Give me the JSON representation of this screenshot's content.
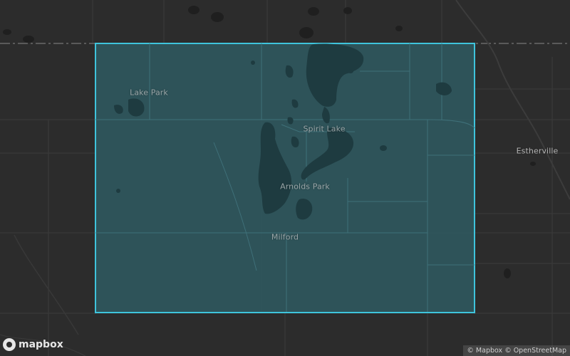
{
  "map": {
    "places": {
      "lake_park": "Lake Park",
      "spirit_lake": "Spirit Lake",
      "arnolds_park": "Arnolds Park",
      "milford": "Milford",
      "estherville": "Estherville"
    },
    "logo_text": "mapbox",
    "attribution": {
      "mapbox": "© Mapbox",
      "osm": "© OpenStreetMap"
    },
    "colors": {
      "background": "#2c2c2c",
      "selection_fill": "#2f5a62",
      "selection_stroke": "#3fc4dc",
      "water": "#1e3b40",
      "roads": "#3a3a3a"
    }
  }
}
